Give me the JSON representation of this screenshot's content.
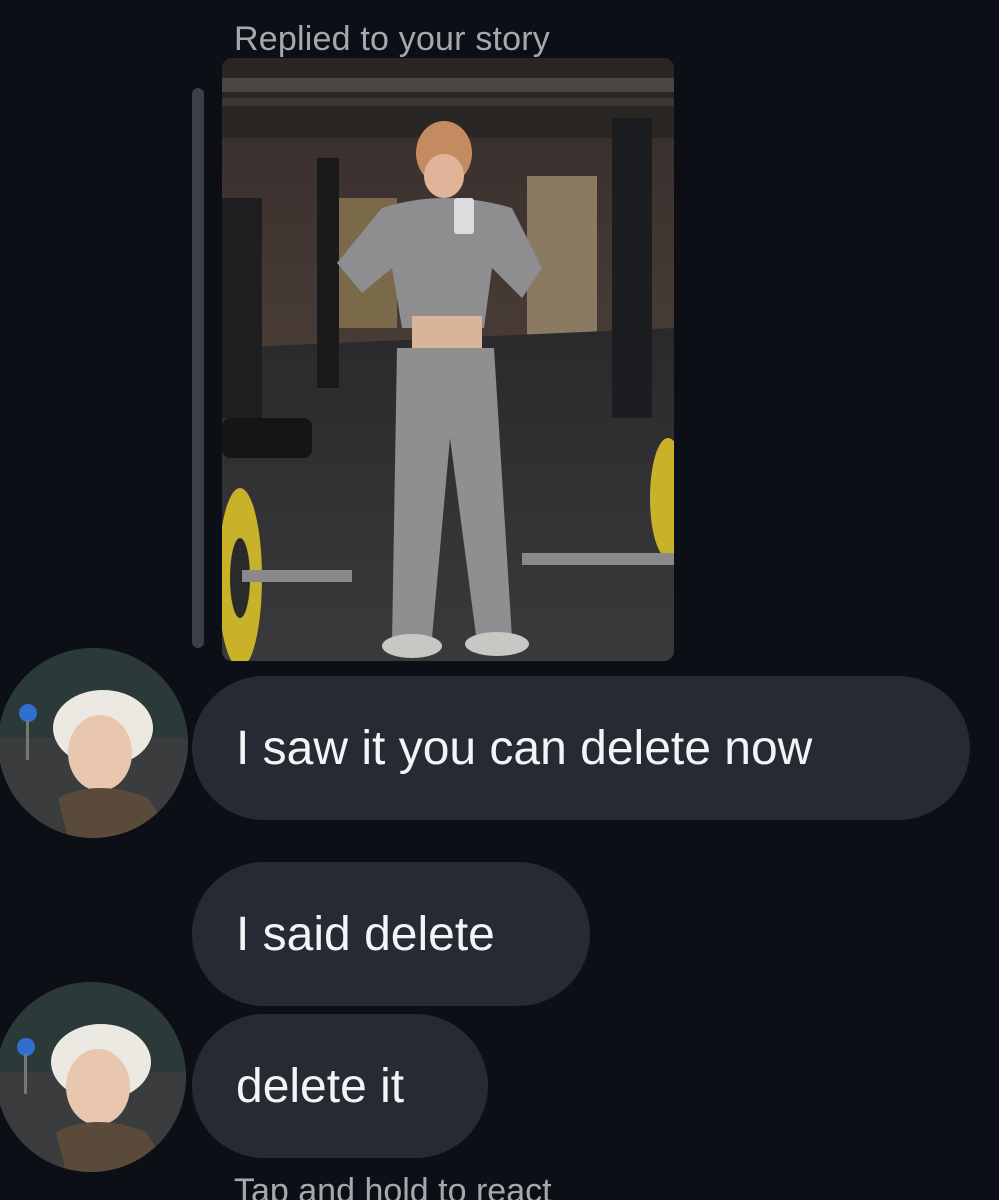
{
  "thread": {
    "reply_label": "Replied to your story",
    "story": {
      "description_icon": "story-photo"
    },
    "messages": [
      {
        "text": "I saw it you can delete now",
        "sender": "contact"
      },
      {
        "text": "I said delete",
        "sender": "contact"
      },
      {
        "text": "delete it",
        "sender": "contact"
      }
    ],
    "hint": "Tap and hold to react"
  },
  "colors": {
    "background": "#0c0f16",
    "bubble": "#262a33",
    "muted_text": "#a6a8ad",
    "reply_bar": "#3b3f47"
  }
}
